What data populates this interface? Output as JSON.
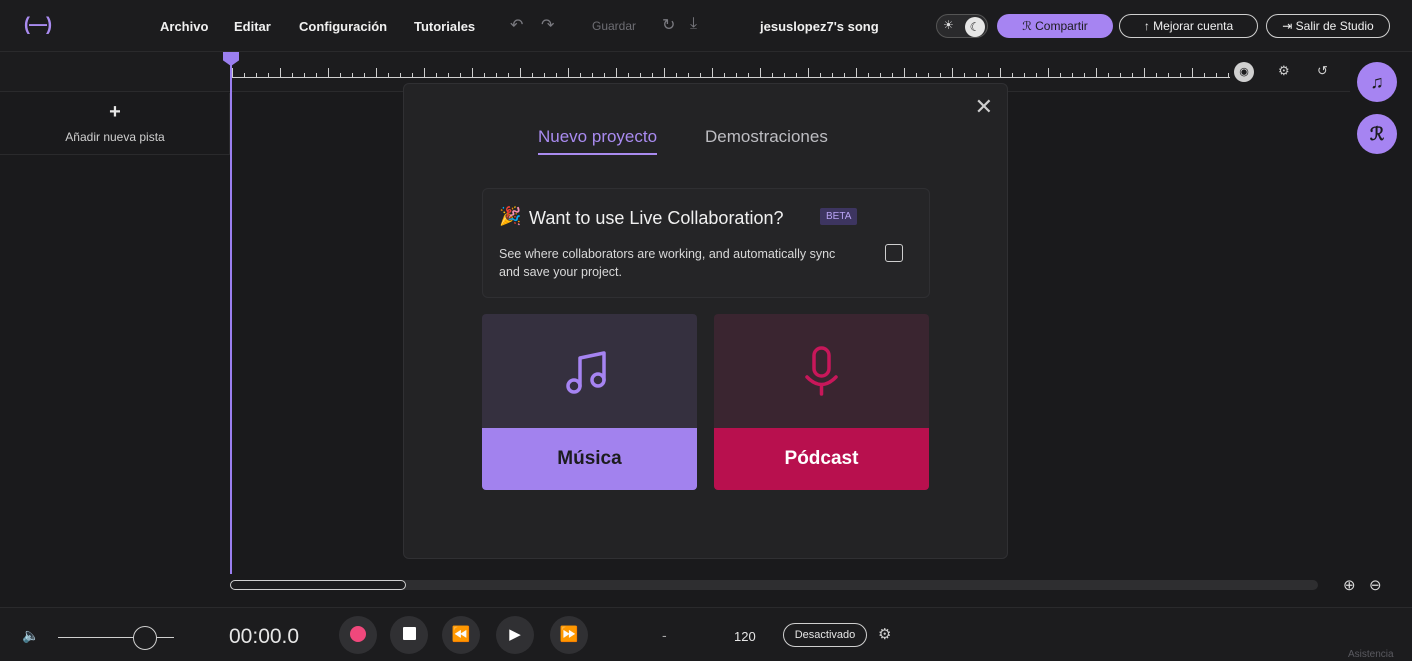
{
  "header": {
    "logo": "(—)",
    "menu": [
      "Archivo",
      "Editar",
      "Configuración",
      "Tutoriales"
    ],
    "save_label": "Guardar",
    "song_title": "jesuslopez7's song",
    "share_label": "Compartir",
    "upgrade_label": "↑ Mejorar cuenta",
    "exit_label": "Salir de Studio",
    "icons": {
      "undo": "↶",
      "redo": "↷",
      "refresh": "↻",
      "download": "⤓",
      "sun": "☀",
      "moon": "☾",
      "share": "ℛ",
      "exit": "⇥"
    }
  },
  "ruler": {
    "icons": [
      "◉",
      "⚙",
      "↺"
    ]
  },
  "tracks": {
    "add_label": "Añadir nueva pista",
    "add_icon": "+"
  },
  "fabs": {
    "music_icon": "♫",
    "collab_icon": "ℛ"
  },
  "modal": {
    "close_icon": "✕",
    "tabs": [
      "Nuevo proyecto",
      "Demostraciones"
    ],
    "collab": {
      "emoji": "🎉",
      "title": "Want to use Live Collaboration?",
      "badge": "BETA",
      "description": "See where collaborators are working, and automatically sync and save your project.",
      "checked": false
    },
    "cards": [
      {
        "label": "Música",
        "icon": "music-note"
      },
      {
        "label": "Pódcast",
        "icon": "microphone"
      }
    ]
  },
  "zoom": {
    "in_icon": "⊕",
    "out_icon": "⊖"
  },
  "transport": {
    "volume_icon": "🔈",
    "volume_level": 0.75,
    "time": "00:00.0",
    "rewind_icon": "⏪",
    "play_icon": "▶",
    "forward_icon": "⏩",
    "dash": "-",
    "bpm": "120",
    "metronome_label": "Desactivado",
    "settings_icon": "⚙",
    "assist_label": "Asistencia"
  },
  "colors": {
    "accent": "#a684f2",
    "podcast": "#b8104e",
    "record": "#f0487c"
  }
}
